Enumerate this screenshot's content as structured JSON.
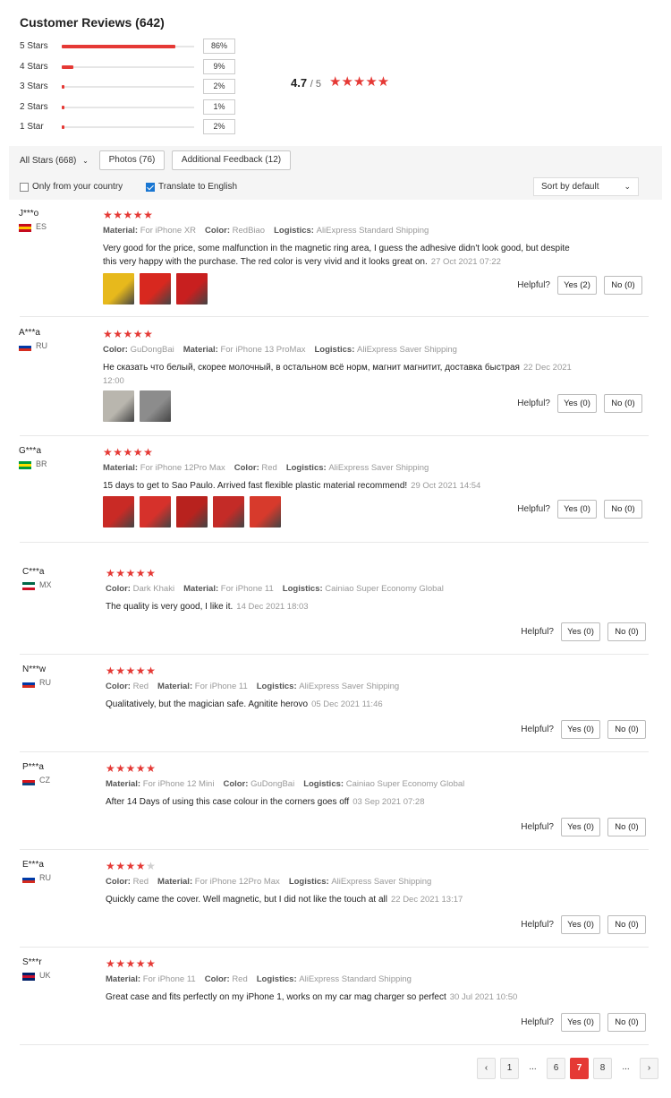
{
  "header": {
    "title": "Customer Reviews (642)"
  },
  "distribution": [
    {
      "label": "5 Stars",
      "pct": "86%",
      "fraction": 0.86
    },
    {
      "label": "4 Stars",
      "pct": "9%",
      "fraction": 0.09
    },
    {
      "label": "3 Stars",
      "pct": "2%",
      "fraction": 0.02
    },
    {
      "label": "2 Stars",
      "pct": "1%",
      "fraction": 0.01
    },
    {
      "label": "1 Star",
      "pct": "2%",
      "fraction": 0.02
    }
  ],
  "rating": {
    "average": "4.7",
    "outof": "/ 5",
    "stars": "★★★★★"
  },
  "filters": {
    "all_stars": "All Stars (668)",
    "photos": "Photos (76)",
    "additional": "Additional Feedback (12)",
    "only_country": "Only from your country",
    "translate": "Translate to English",
    "sort": "Sort by default"
  },
  "helpful_label": "Helpful?",
  "reviews": [
    {
      "name": "J***o",
      "country": "ES",
      "flag": [
        "#c60b1e",
        "#ffc400",
        "#c60b1e"
      ],
      "rating": 5,
      "meta": [
        [
          "Material:",
          "For iPhone XR"
        ],
        [
          "Color:",
          "RedBiao"
        ],
        [
          "Logistics:",
          "AliExpress Standard Shipping"
        ]
      ],
      "text": "Very good for the price, some malfunction in the magnetic ring area, I guess the adhesive didn't look good, but despite this very happy with the purchase. The red color is very vivid and it looks great on.",
      "date": "27 Oct 2021 07:22",
      "thumbs": [
        "#e7b91c",
        "#d8281f",
        "#c81f1f"
      ],
      "yes": "Yes (2)",
      "no": "No (0)"
    },
    {
      "name": "A***a",
      "country": "RU",
      "flag": [
        "#ffffff",
        "#0039a6",
        "#d52b1e"
      ],
      "rating": 5,
      "meta": [
        [
          "Color:",
          "GuDongBai"
        ],
        [
          "Material:",
          "For iPhone 13 ProMax"
        ],
        [
          "Logistics:",
          "AliExpress Saver Shipping"
        ]
      ],
      "text": "Не сказать что белый, скорее молочный, в остальном всё норм, магнит магнитит, доставка быстрая",
      "date": "22 Dec 2021 12:00",
      "thumbs": [
        "#b9b6ae",
        "#8c8c8c"
      ],
      "yes": "Yes (0)",
      "no": "No (0)"
    },
    {
      "name": "G***a",
      "country": "BR",
      "flag": [
        "#009c3b",
        "#ffdf00",
        "#009c3b"
      ],
      "rating": 5,
      "meta": [
        [
          "Material:",
          "For iPhone 12Pro Max"
        ],
        [
          "Color:",
          "Red"
        ],
        [
          "Logistics:",
          "AliExpress Saver Shipping"
        ]
      ],
      "text": "15 days to get to Sao Paulo. Arrived fast flexible plastic material recommend!",
      "date": "29 Oct 2021 14:54",
      "thumbs": [
        "#c92a25",
        "#d6312b",
        "#b8221e",
        "#c42b27",
        "#d73a2c"
      ],
      "yes": "Yes (0)",
      "no": "No (0)"
    },
    {
      "name": "C***a",
      "country": "MX",
      "flag": [
        "#006847",
        "#ffffff",
        "#ce1126"
      ],
      "rating": 5,
      "meta": [
        [
          "Color:",
          "Dark Khaki"
        ],
        [
          "Material:",
          "For iPhone 11"
        ],
        [
          "Logistics:",
          "Cainiao Super Economy Global"
        ]
      ],
      "text": "The quality is very good, I like it.",
      "date": "14 Dec 2021 18:03",
      "thumbs": [],
      "yes": "Yes (0)",
      "no": "No (0)"
    },
    {
      "name": "N***w",
      "country": "RU",
      "flag": [
        "#ffffff",
        "#0039a6",
        "#d52b1e"
      ],
      "rating": 5,
      "meta": [
        [
          "Color:",
          "Red"
        ],
        [
          "Material:",
          "For iPhone 11"
        ],
        [
          "Logistics:",
          "AliExpress Saver Shipping"
        ]
      ],
      "text": "Qualitatively, but the magician safe. Agnitite herovo",
      "date": "05 Dec 2021 11:46",
      "thumbs": [],
      "yes": "Yes (0)",
      "no": "No (0)"
    },
    {
      "name": "P***a",
      "country": "CZ",
      "flag": [
        "#ffffff",
        "#d7141a",
        "#11457e"
      ],
      "rating": 5,
      "meta": [
        [
          "Material:",
          "For iPhone 12 Mini"
        ],
        [
          "Color:",
          "GuDongBai"
        ],
        [
          "Logistics:",
          "Cainiao Super Economy Global"
        ]
      ],
      "text": "After 14 Days of using this case colour in the corners goes off",
      "date": "03 Sep 2021 07:28",
      "thumbs": [],
      "yes": "Yes (0)",
      "no": "No (0)"
    },
    {
      "name": "E***a",
      "country": "RU",
      "flag": [
        "#ffffff",
        "#0039a6",
        "#d52b1e"
      ],
      "rating": 4,
      "meta": [
        [
          "Color:",
          "Red"
        ],
        [
          "Material:",
          "For iPhone 12Pro Max"
        ],
        [
          "Logistics:",
          "AliExpress Saver Shipping"
        ]
      ],
      "text": "Quickly came the cover. Well magnetic, but I did not like the touch at all",
      "date": "22 Dec 2021 13:17",
      "thumbs": [],
      "yes": "Yes (0)",
      "no": "No (0)"
    },
    {
      "name": "S***r",
      "country": "UK",
      "flag": [
        "#012169",
        "#c8102e",
        "#012169"
      ],
      "rating": 5,
      "meta": [
        [
          "Material:",
          "For iPhone 11"
        ],
        [
          "Color:",
          "Red"
        ],
        [
          "Logistics:",
          "AliExpress Standard Shipping"
        ]
      ],
      "text": "Great case and fits perfectly on my iPhone 1, works on my car mag charger so perfect",
      "date": "30 Jul 2021 10:50",
      "thumbs": [],
      "yes": "Yes (0)",
      "no": "No (0)"
    }
  ],
  "pagination": {
    "prev": "‹",
    "pages": [
      "1",
      "...",
      "6",
      "7",
      "8",
      "..."
    ],
    "active": "7",
    "next": "›"
  }
}
